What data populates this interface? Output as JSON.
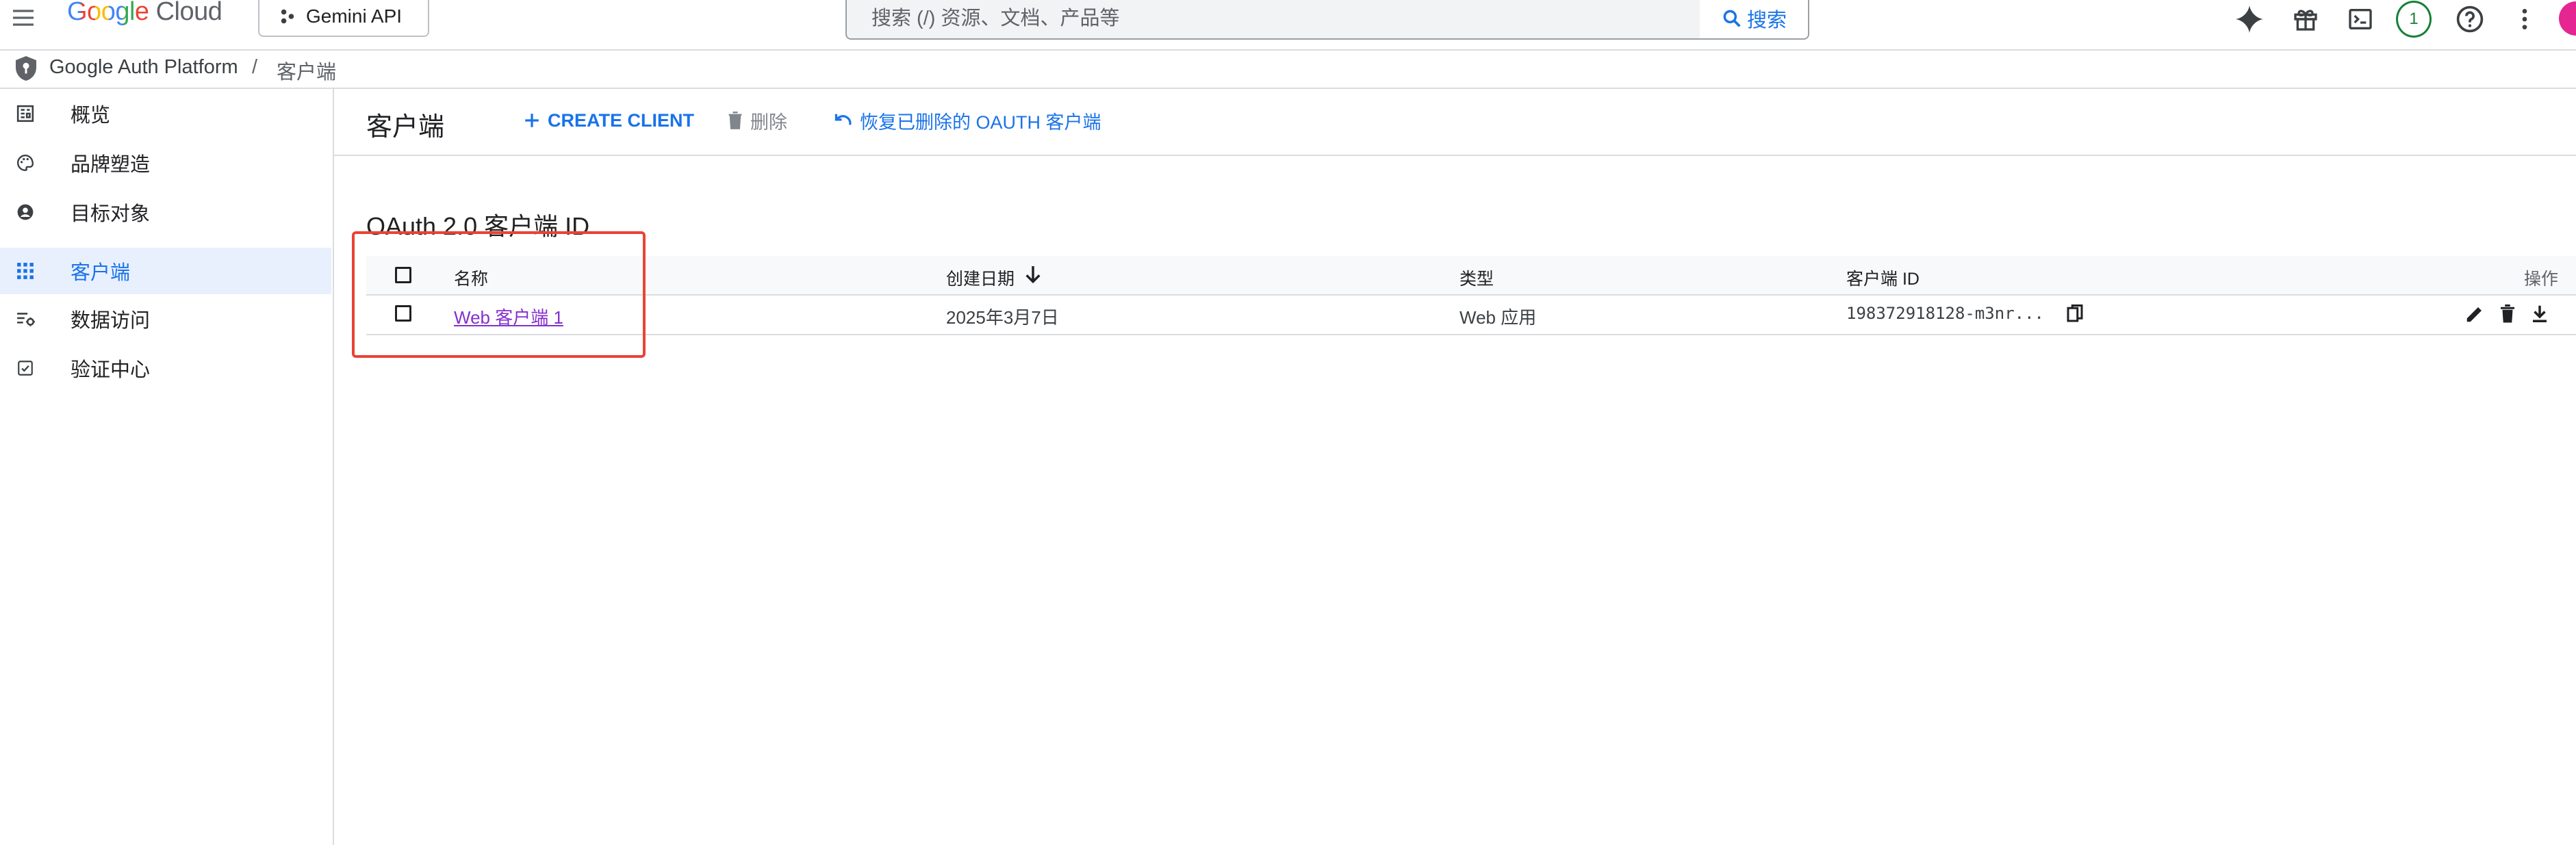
{
  "topbar": {
    "menu_icon": "hamburger-menu-icon",
    "logo": {
      "google": "Google",
      "cloud": "Cloud"
    },
    "project": {
      "label": "Gemini API",
      "icon": "project-dots-icon"
    },
    "search": {
      "placeholder": "搜索 (/) 资源、文档、产品等",
      "button_label": "搜索"
    },
    "icons": [
      "gemini-spark-icon",
      "gift-icon",
      "cloud-shell-terminal-icon",
      "notifications-count-icon",
      "help-icon",
      "more-vert-icon",
      "account-avatar-icon"
    ],
    "notification_count": "1",
    "colors": {
      "brand_blue": "#1a73e8",
      "notif_green": "#188038",
      "avatar_pink": "#e52592"
    }
  },
  "breadcrumb": {
    "root": "Google Auth Platform",
    "separator": "/",
    "current": "客户端"
  },
  "sidebar": {
    "items": [
      {
        "label": "概览",
        "icon": "dashboard-icon",
        "active": false
      },
      {
        "label": "品牌塑造",
        "icon": "palette-icon",
        "active": false
      },
      {
        "label": "目标对象",
        "icon": "account-circle-icon",
        "active": false
      },
      {
        "label": "客户端",
        "icon": "apps-grid-icon",
        "active": true
      },
      {
        "label": "数据访问",
        "icon": "data-settings-icon",
        "active": false
      },
      {
        "label": "验证中心",
        "icon": "verified-check-icon",
        "active": false
      }
    ]
  },
  "header": {
    "title": "客户端",
    "create_label": "CREATE CLIENT",
    "delete_label": "删除",
    "restore_label": "恢复已删除的 OAUTH 客户端"
  },
  "section": {
    "title": "OAuth 2.0 客户端 ID"
  },
  "table": {
    "columns": {
      "name": "名称",
      "created": "创建日期",
      "type": "类型",
      "client_id": "客户端 ID",
      "actions": "操作"
    },
    "rows": [
      {
        "name": "Web 客户端 1",
        "created": "2025年3月7日",
        "type": "Web 应用",
        "client_id": "198372918128-m3nr..."
      }
    ]
  },
  "annotation": {
    "highlight_color": "#ea4335"
  }
}
